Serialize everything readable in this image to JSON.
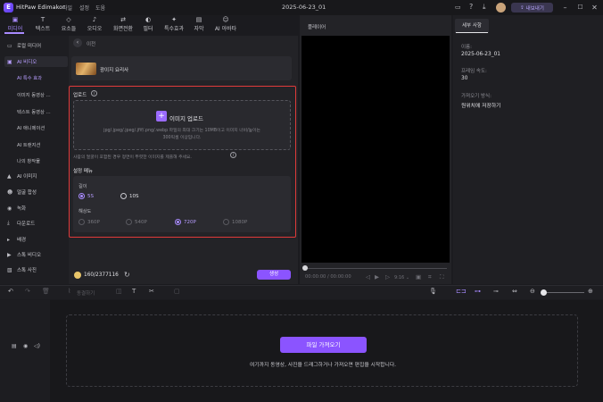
{
  "titlebar": {
    "app_title": "HitPaw Edimakor",
    "menus": [
      "파일",
      "설정",
      "도움"
    ],
    "project_name": "2025-06-23_01",
    "export_label": "내보내기"
  },
  "top_tabs": [
    "미디어",
    "텍스트",
    "요소들",
    "오디오",
    "화면전환",
    "필터",
    "특수효과",
    "자막",
    "AI 아바타"
  ],
  "sidebar": {
    "items": [
      "로컬 미디어",
      "AI 비디오",
      "AI 이미지",
      "얼굴 합성",
      "녹화",
      "다운로드",
      "배경",
      "스톡 비디오",
      "스톡 사진"
    ],
    "sub_items": [
      "AI 특수 효과",
      "이미지 동영상 ...",
      "텍스트 동영상 ...",
      "AI 애니메이션",
      "AI 트랜지션",
      "나의 창작물"
    ]
  },
  "panel": {
    "back_label": "이전",
    "template_name": "광이지 요리사",
    "upload_label": "업로드",
    "upload_button": "이미지 업로드",
    "upload_hint_1": "jpg/.jpeg/.jpeg/.jfif/.png/.webp 파일의 최대 크기는 10MB이고 이미지 너비/높이는",
    "upload_hint_2": "300픽셀 이상입니다.",
    "note": "사람의 얼굴이 포함된 경우 정면이 뚜렷한 이미지를 제출해 주세요.",
    "settings_label": "설정 메뉴",
    "length_label": "길이",
    "length_options": [
      "5S",
      "10S"
    ],
    "resolution_label": "해상도",
    "resolution_options": [
      "360P",
      "540P",
      "720P",
      "1080P"
    ],
    "credits": "160/2377116",
    "generate_label": "생성"
  },
  "player": {
    "title": "플레이어",
    "time": "00:00:00 / 00:00:00",
    "ratio": "9:16"
  },
  "details": {
    "tab": "세부 사항",
    "name_label": "이름:",
    "name_value": "2025-06-23_01",
    "fps_label": "프레임 속도:",
    "fps_value": "30",
    "save_label": "가져오기 방식:",
    "save_value": "원위치에 저장하기"
  },
  "timeline": {
    "freeze_label": "동결하기",
    "import_button": "파일 가져오기",
    "import_hint": "여기까지 동영상, 사진을 드래그하거나 가져오면 편집을 시작합니다."
  },
  "colors": {
    "accent": "#8b54ff",
    "highlight_border": "#e03a3a"
  }
}
